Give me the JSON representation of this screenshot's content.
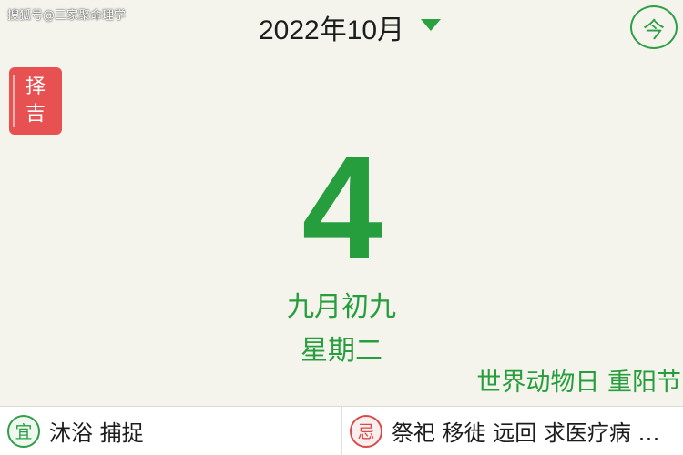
{
  "watermark": "搜狐号@三家聚命理学",
  "header": {
    "month_label": "2022年10月",
    "dropdown_icon": "triangle-down-icon",
    "today_label": "今"
  },
  "zeji": {
    "line1": "择",
    "line2": "吉"
  },
  "day": {
    "number": "4",
    "lunar": "九月初九",
    "weekday": "星期二",
    "festival": "世界动物日 重阳节"
  },
  "bottom": {
    "yi_badge": "宜",
    "yi_text": "沐浴 捕捉",
    "ji_badge": "忌",
    "ji_text": "祭祀 移徙 远回 求医疗病 …"
  },
  "colors": {
    "accent_green": "#269e3d",
    "zeji_red": "#e85151",
    "background": "#f4f4ec"
  }
}
